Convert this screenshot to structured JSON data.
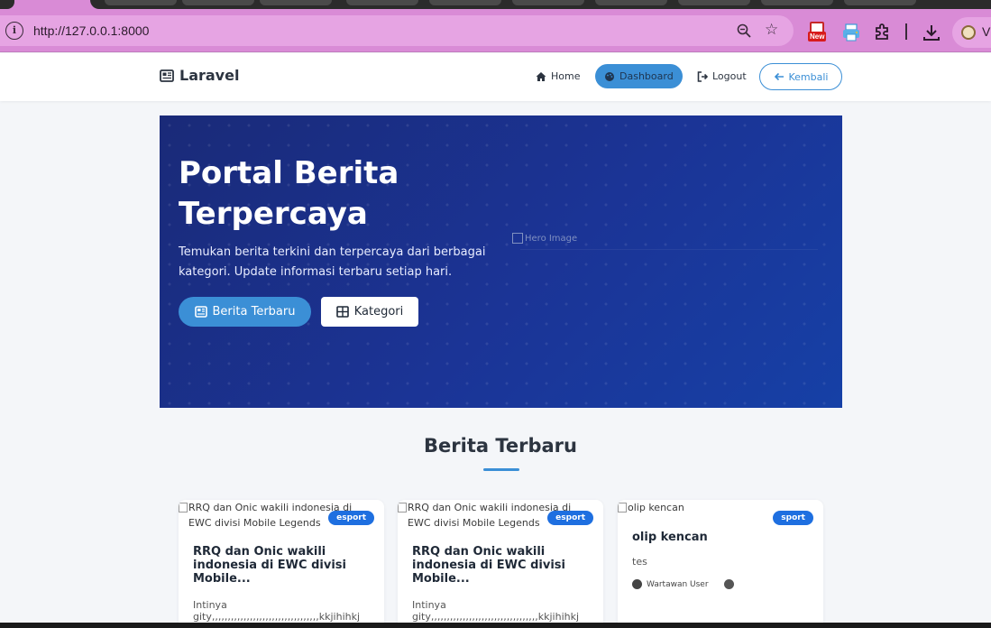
{
  "browser": {
    "url": "http://127.0.0.1:8000",
    "new_badge": "New",
    "profile_letter": "V"
  },
  "navbar": {
    "brand": "Laravel",
    "links": [
      {
        "label": "Home",
        "icon": "home-icon"
      },
      {
        "label": "Dashboard",
        "icon": "palette-icon",
        "active": true
      },
      {
        "label": "Logout",
        "icon": "logout-icon"
      },
      {
        "label": "Kembali",
        "icon": "arrow-left-icon"
      }
    ]
  },
  "hero": {
    "title": "Portal Berita Terpercaya",
    "subtitle": "Temukan berita terkini dan terpercaya dari berbagai kategori. Update informasi terbaru setiap hari.",
    "btn_latest": "Berita Terbaru",
    "btn_categories": "Kategori",
    "image_alt": "Hero Image"
  },
  "section": {
    "title": "Berita Terbaru"
  },
  "cards": [
    {
      "image_alt": "RRQ dan Onic wakili indonesia di EWC divisi Mobile Legends",
      "badge": "esport",
      "title": "RRQ dan Onic wakili indonesia di EWC divisi Mobile...",
      "excerpt": "Intinya gity,,,,,,,,,,,,,,,,,,,,,,,,,,,,,,,,,,kkjihihkj"
    },
    {
      "image_alt": "RRQ dan Onic wakili indonesia di EWC divisi Mobile Legends",
      "badge": "esport",
      "title": "RRQ dan Onic wakili indonesia di EWC divisi Mobile...",
      "excerpt": "Intinya gity,,,,,,,,,,,,,,,,,,,,,,,,,,,,,,,,,,kkjihihkj"
    },
    {
      "image_alt": "olip kencan",
      "badge": "sport",
      "title": "olip kencan",
      "excerpt": "tes",
      "author": "Wartawan User"
    }
  ],
  "colors": {
    "accent": "#3b8fd6",
    "badge": "#1e6fe0",
    "hero_start": "#1a2a78",
    "hero_end": "#1640a6",
    "browser_frame": "#d98bd6"
  }
}
